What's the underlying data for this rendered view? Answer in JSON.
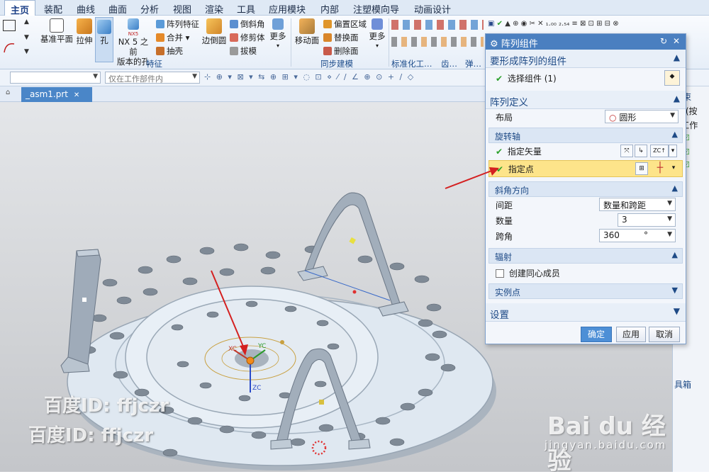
{
  "menubar": {
    "items": [
      "主页",
      "装配",
      "曲线",
      "曲面",
      "分析",
      "视图",
      "渲染",
      "工具",
      "应用模块",
      "内部",
      "注塑模向导",
      "动画设计"
    ]
  },
  "ribbon": {
    "datum_plane": "基准平面",
    "extrude": "拉伸",
    "hole": "孔",
    "nx5_hole_line1": "NX 5 之前",
    "nx5_hole_line2": "版本的孔",
    "nx5_badge": "NX5",
    "pattern_feature": "阵列特征",
    "unite": "合并",
    "shell": "抽壳",
    "edge_blend": "边倒圆",
    "chamfer": "倒斜角",
    "trim_body": "修剪体",
    "draft": "拔模",
    "more1": "更多",
    "move_face": "移动面",
    "offset_region": "偏置区域",
    "replace_face": "替换面",
    "delete_face": "删除面",
    "more2": "更多",
    "group_feature": "特征",
    "group_sync": "同步建模",
    "group_std": "标准化工…",
    "group_gear": "齿…",
    "group_spring": "弹…"
  },
  "selbar": {
    "filter_value": "",
    "scope_placeholder": "仅在工作部件内"
  },
  "tabs": {
    "doc_tab": "_asm1.prt"
  },
  "dialog": {
    "title": "阵列组件",
    "sec_components": "要形成阵列的组件",
    "select_components": "选择组件 (1)",
    "sec_pattern_def": "阵列定义",
    "layout_label": "布局",
    "layout_value": "圆形",
    "sub_axis": "旋转轴",
    "specify_vector": "指定矢量",
    "specify_point": "指定点",
    "sub_angular": "斜角方向",
    "spacing_label": "间距",
    "spacing_value": "数量和跨距",
    "count_label": "数量",
    "count_value": "3",
    "span_label": "跨角",
    "span_value": "360",
    "span_unit": "°",
    "sub_radiate": "辐射",
    "concentric_label": "创建同心成员",
    "sub_instance": "实例点",
    "sec_settings": "设置",
    "ok": "确定",
    "apply": "应用",
    "cancel": "取消",
    "zc_label": "ZC"
  },
  "navpanel": {
    "constraints": "约束",
    "name": "称 (按",
    "work": "工作",
    "tools": "具箱"
  },
  "viewport": {
    "axis_xc": "XC",
    "axis_yc": "YC",
    "axis_zc": "ZC"
  },
  "watermarks": {
    "baidu_id1": "百度ID: ffjczr",
    "baidu_id2": "百度ID: ffjczr",
    "baidu_jingyan": "Bai du 经验",
    "jingyan_url": "jingyan.baidu.com"
  },
  "colors": {
    "accent": "#4a7fc0",
    "highlight_row": "#fde48a",
    "arrow": "#d42020",
    "check": "#2aa02a"
  }
}
